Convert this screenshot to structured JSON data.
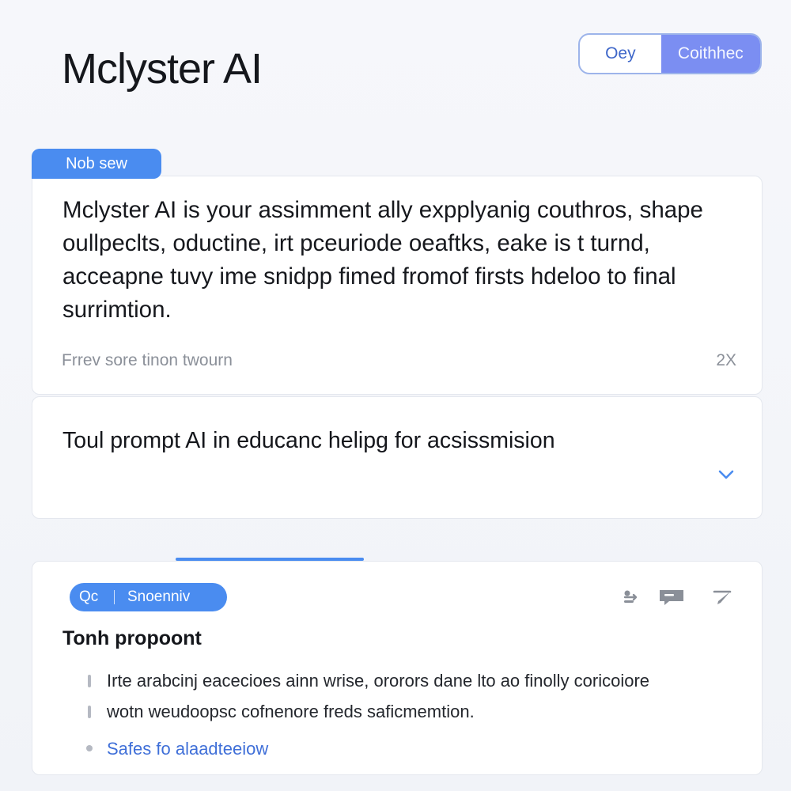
{
  "header": {
    "title": "Mclyster AI",
    "toggle": {
      "options": [
        "Oey",
        "Coithhec"
      ],
      "selected": "Coithhec"
    }
  },
  "intro": {
    "tag": "Nob sew",
    "text": "Mclyster AI is your assimment ally expplyanig couthros, shape oullpeclts, oductine, irt pceuriode oeaftks, eake is t turnd, acceapne tuvy ime snidpp fimed fromof firsts hdeloo to final surrimtion.",
    "footnote": "Frrev sore tinon twourn",
    "count": "2X"
  },
  "prompt_card": {
    "text": "Toul prompt AI in educanc helipg for acsissmision",
    "chevron_icon": "chevron-down-icon"
  },
  "workspace": {
    "search_pill": {
      "prefix": "Qc",
      "label": "Snoenniv"
    },
    "tools": [
      "share-icon",
      "comment-icon",
      "edit-icon"
    ],
    "section_title": "Tonh propoont",
    "bullets": [
      "Irte arabcinj eacecioes ainn wrise, ororors dane lto ao finolly coricoiore",
      "wotn weudoopsc cofnenore freds saficmemtion."
    ],
    "link": "Safes fo alaadteeiow"
  },
  "colors": {
    "accent": "#4a8cf0",
    "toggle_active": "#7b8ef2",
    "link": "#3f6fd8",
    "muted_text": "#8b9099"
  }
}
